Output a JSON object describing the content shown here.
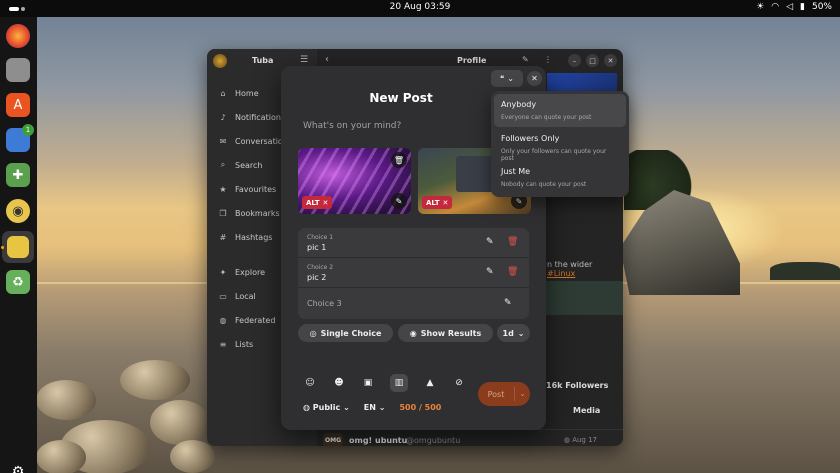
{
  "topbar": {
    "clock": "20 Aug  03:59",
    "battery": "50%"
  },
  "dock": {
    "items": [
      {
        "name": "firefox-icon",
        "glyph": "🦊"
      },
      {
        "name": "files-icon",
        "glyph": "▭"
      },
      {
        "name": "app-center-icon",
        "glyph": "A"
      },
      {
        "name": "tuba-badge-app-icon",
        "glyph": "▣",
        "badge": "1"
      },
      {
        "name": "extensions-icon",
        "glyph": "✚"
      },
      {
        "name": "rhythmbox-icon",
        "glyph": "◉"
      },
      {
        "name": "tuba-icon",
        "glyph": "♫"
      },
      {
        "name": "trash-icon",
        "glyph": "♻"
      }
    ]
  },
  "window": {
    "app_title": "Tuba",
    "header_title": "Profile",
    "nav": [
      {
        "label": "Home",
        "icon": "home-icon",
        "glyph": "⌂"
      },
      {
        "label": "Notifications",
        "icon": "bell-icon",
        "glyph": "🔔"
      },
      {
        "label": "Conversations",
        "icon": "chat-icon",
        "glyph": "✉"
      },
      {
        "label": "Search",
        "icon": "search-icon",
        "glyph": "⌕"
      },
      {
        "label": "Favourites",
        "icon": "star-icon",
        "glyph": "★"
      },
      {
        "label": "Bookmarks",
        "icon": "bookmark-icon",
        "glyph": "❐"
      },
      {
        "label": "Hashtags",
        "icon": "hashtag-icon",
        "glyph": "#"
      },
      {
        "label": "Explore",
        "icon": "explore-icon",
        "glyph": "✦"
      },
      {
        "label": "Local",
        "icon": "local-icon",
        "glyph": "▭"
      },
      {
        "label": "Federated",
        "icon": "globe-icon",
        "glyph": "◍"
      },
      {
        "label": "Lists",
        "icon": "list-icon",
        "glyph": "≡"
      }
    ],
    "background_text": "n the wider ",
    "background_link": "#Linux",
    "followers": "16k Followers",
    "media_tab": "Media",
    "post": {
      "avatar": "OMG",
      "name": "omg! ubuntu",
      "handle": "@omgubuntu",
      "date": "Aug 17"
    }
  },
  "dialog": {
    "title": "New Post",
    "compose_placeholder": "What's on your mind?",
    "attachments": [
      {
        "alt_label": "ALT"
      },
      {
        "alt_label": "ALT"
      }
    ],
    "poll": {
      "choices": [
        {
          "label": "Choice 1",
          "value": "pic 1"
        },
        {
          "label": "Choice 2",
          "value": "pic 2"
        }
      ],
      "empty_choice": "Choice 3"
    },
    "single_choice": "Single Choice",
    "show_results": "Show Results",
    "duration": "1d",
    "visibility": "Public",
    "language": "EN",
    "char_count": "500 / 500",
    "post_button": "Post"
  },
  "quote_popover": {
    "options": [
      {
        "title": "Anybody",
        "desc": "Everyone can quote your post"
      },
      {
        "title": "Followers Only",
        "desc": "Only your followers can quote your post"
      },
      {
        "title": "Just Me",
        "desc": "Nobody can quote your post"
      }
    ],
    "selected": "Anybody"
  }
}
